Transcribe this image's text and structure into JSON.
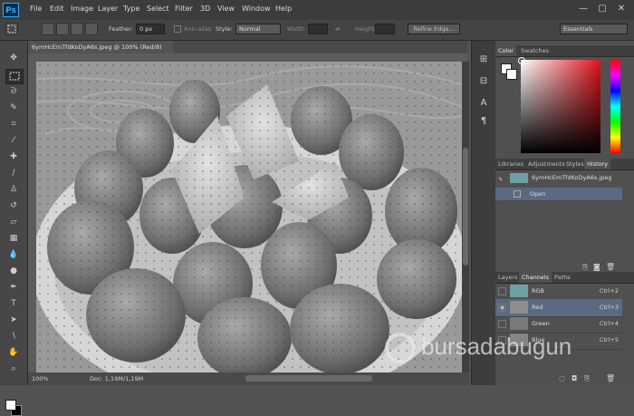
{
  "app": {
    "logo": "Ps"
  },
  "menu": [
    "File",
    "Edit",
    "Image",
    "Layer",
    "Type",
    "Select",
    "Filter",
    "3D",
    "View",
    "Window",
    "Help"
  ],
  "window_controls": {
    "minimize": "—",
    "maximize": "▢",
    "close": "✕"
  },
  "options_bar": {
    "feather_label": "Feather:",
    "feather_value": "0 px",
    "antialias_label": "Anti-alias",
    "style_label": "Style:",
    "style_value": "Normal",
    "width_label": "Width:",
    "height_label": "Height:",
    "refine_edge": "Refine Edge...",
    "workspace": "Essentials"
  },
  "document": {
    "tab_title": "6ymHcEmTfdKoDyA6s.jpeg @ 100% (Red/8)",
    "zoom": "100%",
    "doc_size": "Doc: 1,19M/1,19M"
  },
  "color_panel": {
    "tabs": [
      "Color",
      "Swatches"
    ],
    "active": "Color"
  },
  "history_panel": {
    "tabs": [
      "Libraries",
      "Adjustments",
      "Styles",
      "History"
    ],
    "active": "History",
    "snapshot": "6ymHcEmTfdKoDyA6s.jpeg",
    "states": [
      "Open"
    ]
  },
  "channels_panel": {
    "tabs": [
      "Layers",
      "Channels",
      "Paths"
    ],
    "active": "Channels",
    "channels": [
      {
        "name": "RGB",
        "shortcut": "Ctrl+2",
        "visible": false,
        "selected": false
      },
      {
        "name": "Red",
        "shortcut": "Ctrl+3",
        "visible": true,
        "selected": true
      },
      {
        "name": "Green",
        "shortcut": "Ctrl+4",
        "visible": false,
        "selected": false
      },
      {
        "name": "Blue",
        "shortcut": "Ctrl+5",
        "visible": false,
        "selected": false
      }
    ]
  },
  "watermark": "bursadabugun",
  "colors": {
    "accent": "#31a8ff",
    "selection": "#5b6a82"
  }
}
